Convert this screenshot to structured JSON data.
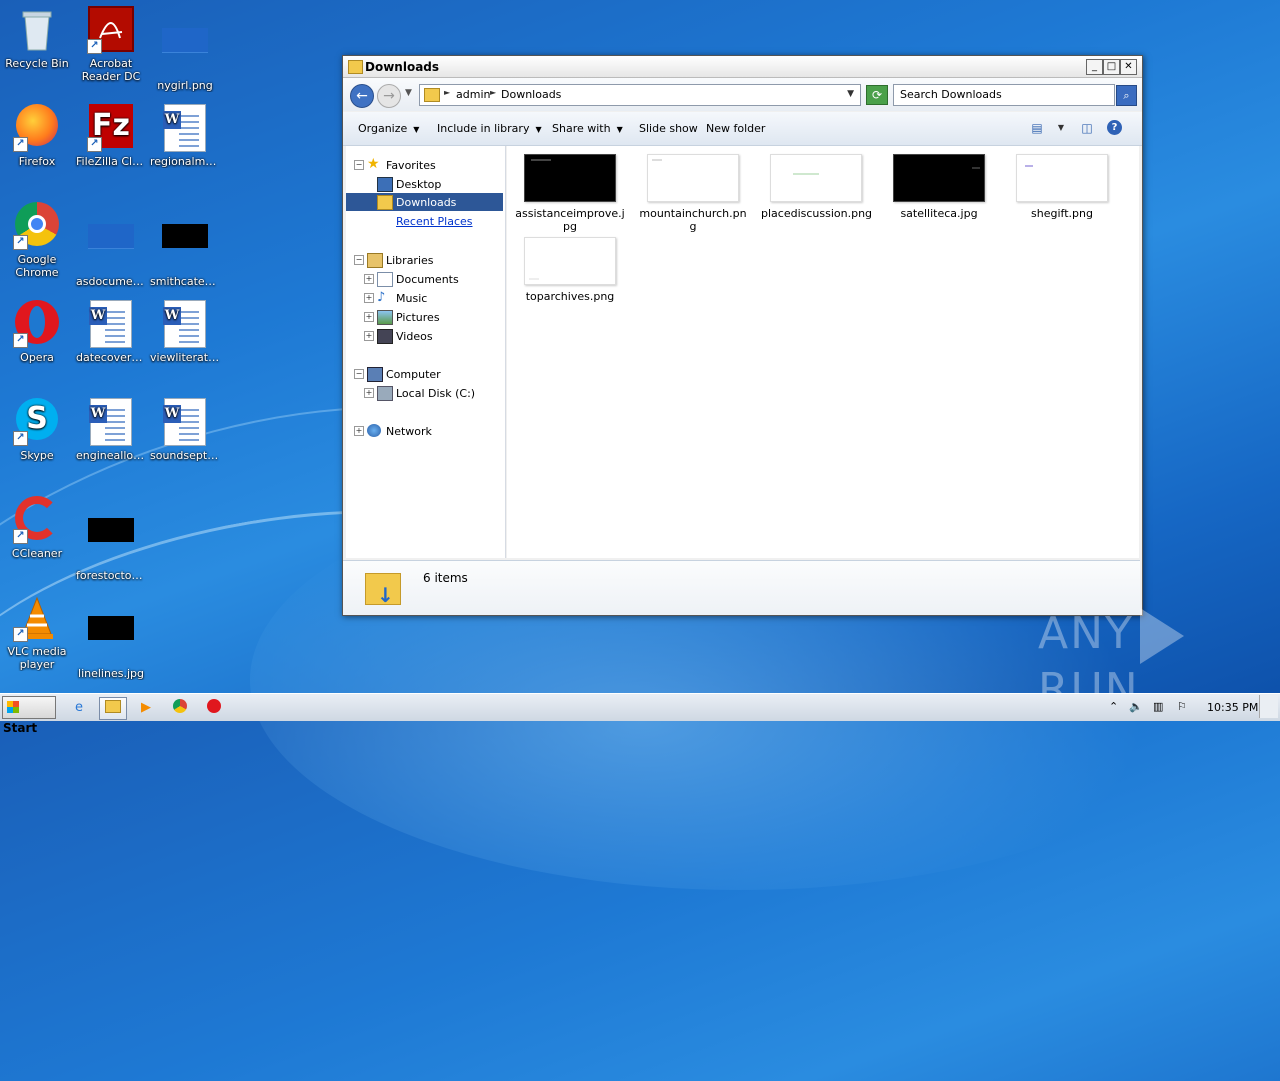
{
  "desktop": {
    "icons": [
      {
        "name": "Recycle Bin"
      },
      {
        "name": "Acrobat Reader DC"
      },
      {
        "name": "nygirl.png"
      },
      {
        "name": "Firefox"
      },
      {
        "name": "FileZilla Client"
      },
      {
        "name": "regionalmo..."
      },
      {
        "name": "Google Chrome"
      },
      {
        "name": "asdocument..."
      },
      {
        "name": "smithcatego..."
      },
      {
        "name": "Opera"
      },
      {
        "name": "datecovera..."
      },
      {
        "name": "viewliteratu..."
      },
      {
        "name": "Skype"
      },
      {
        "name": "engineallow..."
      },
      {
        "name": "soundsepte..."
      },
      {
        "name": "CCleaner"
      },
      {
        "name": "forestoctob..."
      },
      {
        "name": "VLC media player"
      },
      {
        "name": "linelines.jpg"
      }
    ]
  },
  "window": {
    "title": "Downloads",
    "breadcrumb": [
      "admin",
      "Downloads"
    ],
    "search_placeholder": "Search Downloads",
    "toolbar": {
      "organize": "Organize",
      "include": "Include in library",
      "share": "Share with",
      "slideshow": "Slide show",
      "newfolder": "New folder"
    },
    "nav": {
      "favorites": "Favorites",
      "desktop": "Desktop",
      "downloads": "Downloads",
      "recent": "Recent Places",
      "libraries": "Libraries",
      "documents": "Documents",
      "music": "Music",
      "pictures": "Pictures",
      "videos": "Videos",
      "computer": "Computer",
      "localdisk": "Local Disk (C:)",
      "network": "Network"
    },
    "files": [
      {
        "name": "assistanceimprove.jpg",
        "line1": "assistanceimprove.j",
        "line2": "pg",
        "thumb": "black"
      },
      {
        "name": "mountainchurch.png",
        "line1": "mountainchurch.pn",
        "line2": "g",
        "thumb": "white"
      },
      {
        "name": "placediscussion.png",
        "line1": "placediscussion.png",
        "line2": "",
        "thumb": "white"
      },
      {
        "name": "satelliteca.jpg",
        "line1": "satelliteca.jpg",
        "line2": "",
        "thumb": "black"
      },
      {
        "name": "shegift.png",
        "line1": "shegift.png",
        "line2": "",
        "thumb": "white"
      },
      {
        "name": "toparchives.png",
        "line1": "toparchives.png",
        "line2": "",
        "thumb": "white"
      }
    ],
    "status": "6 items"
  },
  "watermark": {
    "left": "ANY",
    "right": "RUN"
  },
  "taskbar": {
    "start": "Start",
    "clock": "10:35 PM"
  }
}
